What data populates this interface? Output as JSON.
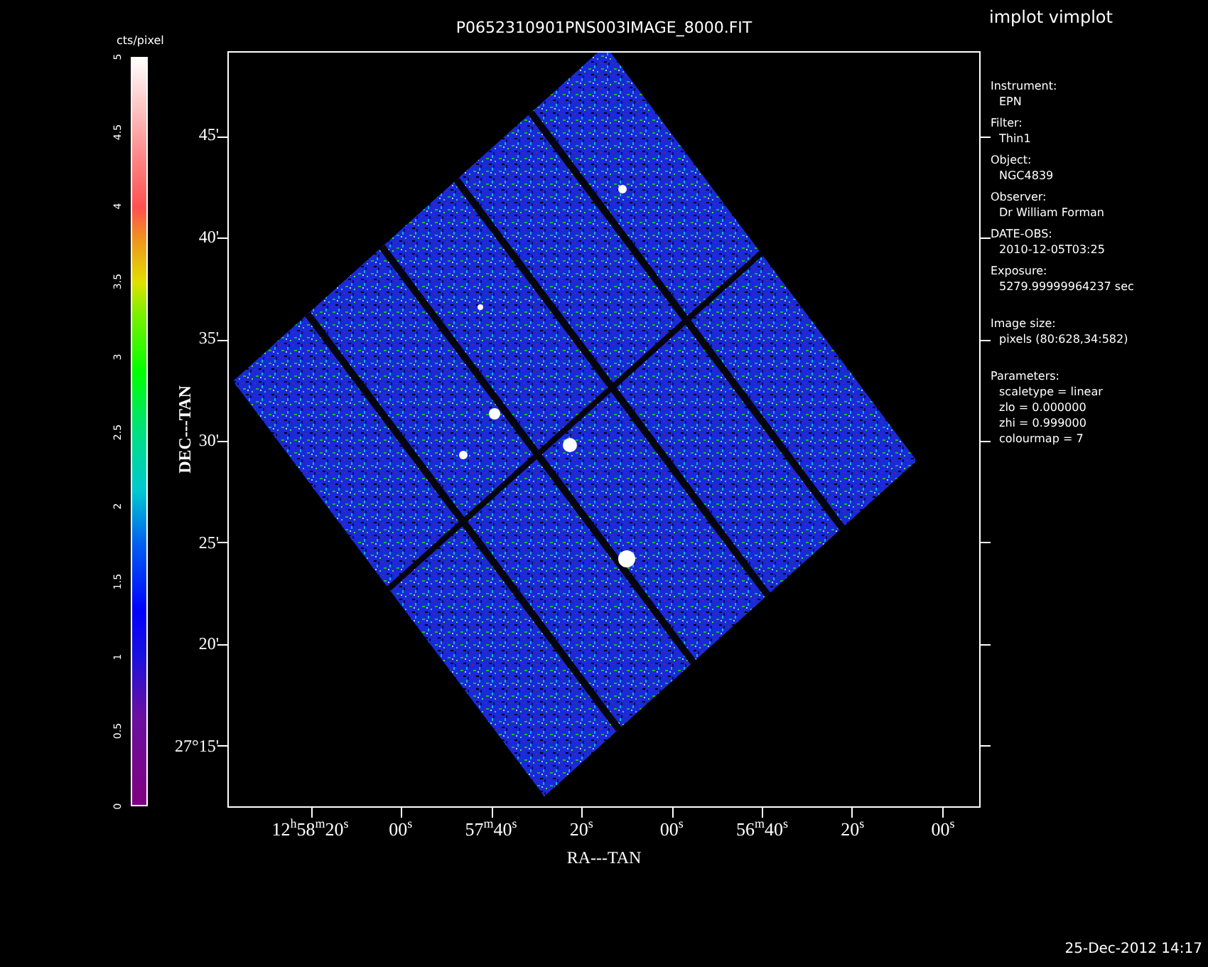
{
  "program": {
    "title": "implot vimplot"
  },
  "plot": {
    "title": "P0652310901PNS003IMAGE_8000.FIT",
    "xlabel": "RA---TAN",
    "ylabel": "DEC---TAN",
    "xticks": [
      "12$^{h}$58$^{m}$20$^{s}$",
      "00$^{s}$",
      "57$^{m}$40$^{s}$",
      "20$^{s}$",
      "00$^{s}$",
      "56$^{m}$40$^{s}$",
      "20$^{s}$",
      "00$^{s}$"
    ],
    "yticks": [
      "45'",
      "40'",
      "35'",
      "30'",
      "25'",
      "20'",
      "27°15'"
    ]
  },
  "colorbar": {
    "label": "cts/pixel",
    "ticks": [
      "0",
      "0.5",
      "1",
      "1.5",
      "2",
      "2.5",
      "3",
      "3.5",
      "4",
      "4.5",
      "5"
    ]
  },
  "info": {
    "sections": [
      [
        {
          "label": "Instrument:",
          "lines": [
            "EPN"
          ]
        },
        {
          "label": "Filter:",
          "lines": [
            "Thin1"
          ]
        },
        {
          "label": "Object:",
          "lines": [
            "NGC4839"
          ]
        },
        {
          "label": "Observer:",
          "lines": [
            "Dr William Forman"
          ]
        },
        {
          "label": "DATE-OBS:",
          "lines": [
            "2010-12-05T03:25"
          ]
        },
        {
          "label": "Exposure:",
          "lines": [
            "5279.99999964237 sec"
          ]
        }
      ],
      [
        {
          "label": "Image size:",
          "lines": [
            "pixels (80:628,34:582)"
          ]
        }
      ],
      [
        {
          "label": "Parameters:",
          "lines": [
            "scaletype = linear",
            "zlo = 0.000000",
            "zhi = 0.999000",
            "colourmap =    7"
          ]
        }
      ]
    ]
  },
  "timestamp": "25-Dec-2012 14:17"
}
